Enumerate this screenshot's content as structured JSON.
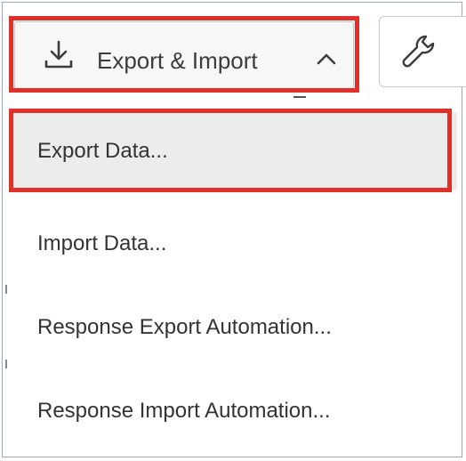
{
  "toolbar": {
    "export_import_label": "Export & Import",
    "export_import_icon": "download-icon",
    "export_import_chevron": "chevron-up-icon",
    "tools_icon": "wrench-icon"
  },
  "menu": {
    "items": [
      {
        "label": "Export Data...",
        "active": true
      },
      {
        "label": "Import Data..."
      },
      {
        "label": "Response Export Automation..."
      },
      {
        "label": "Response Import Automation..."
      }
    ]
  },
  "colors": {
    "highlight": "#e0302a",
    "button_bg": "#f7f7f7",
    "active_item_bg": "#ececec",
    "text": "#333333"
  }
}
